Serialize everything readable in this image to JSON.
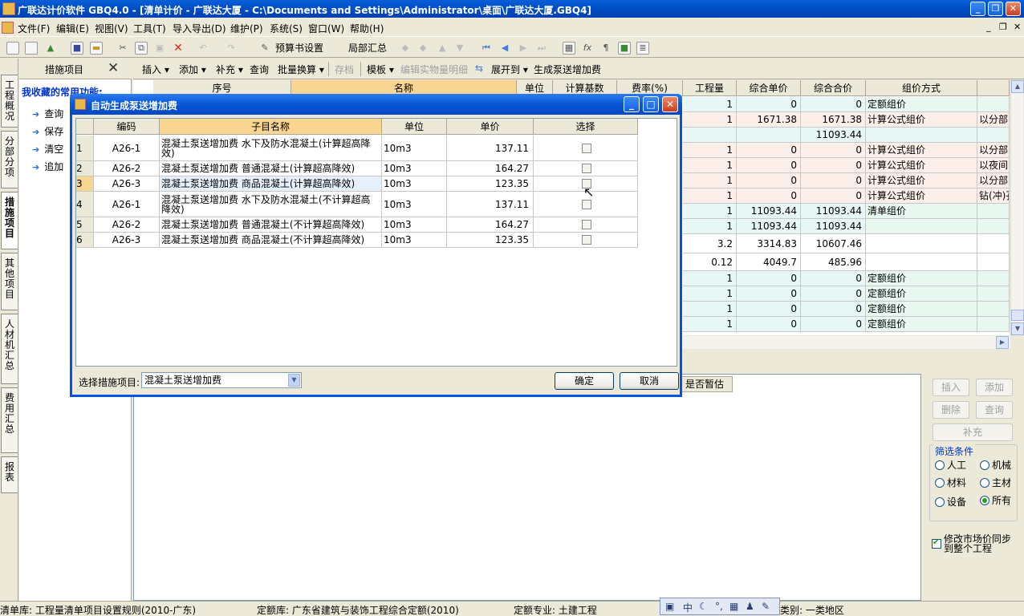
{
  "window": {
    "title": "广联达计价软件 GBQ4.0 - [清单计价 - 广联达大厦 - C:\\Documents and Settings\\Administrator\\桌面\\广联达大厦.GBQ4]"
  },
  "menubar": {
    "items": [
      "文件(F)",
      "编辑(E)",
      "视图(V)",
      "工具(T)",
      "导入导出(D)",
      "维护(P)",
      "系统(S)",
      "窗口(W)",
      "帮助(H)"
    ]
  },
  "toolbar": {
    "budget_settings": "预算书设置",
    "local_summary": "局部汇总"
  },
  "left_tabs": [
    "工程概况",
    "分部分项",
    "措施项目",
    "其他项目",
    "人材机汇总",
    "费用汇总",
    "报表"
  ],
  "left_panel": {
    "title": "措施项目",
    "favorites_title": "我收藏的常用功能:",
    "items": [
      "查询",
      "保存",
      "清空",
      "追加"
    ]
  },
  "toolbar2": {
    "insert": "插入",
    "add": "添加",
    "supplement": "补充",
    "query": "查询",
    "batch_convert": "批量换算",
    "archive": "存档",
    "template": "模板",
    "edit_detail": "编辑实物量明细",
    "expand_to": "展开到",
    "generate_pump": "生成泵送增加费"
  },
  "grid": {
    "headers": [
      "序号",
      "名称",
      "单位",
      "计算基数",
      "费率(%)",
      "工程量",
      "综合单价",
      "综合合价",
      "组价方式"
    ],
    "rows": [
      {
        "qty": "1",
        "unit_price": "0",
        "total": "0",
        "method": "定额组价",
        "extra": "",
        "bg": "#E8F8F0"
      },
      {
        "qty": "1",
        "unit_price": "1671.38",
        "total": "1671.38",
        "method": "计算公式组价",
        "extra": "以分部:",
        "bg": "#FCEEE8"
      },
      {
        "qty": "",
        "unit_price": "",
        "total": "11093.44",
        "method": "",
        "extra": "",
        "bg": "#E8F8F4"
      },
      {
        "qty": "1",
        "unit_price": "0",
        "total": "0",
        "method": "计算公式组价",
        "extra": "以分部:",
        "bg": "#FCEEE8"
      },
      {
        "qty": "1",
        "unit_price": "0",
        "total": "0",
        "method": "计算公式组价",
        "extra": "以夜间:",
        "bg": "#FCEEE8"
      },
      {
        "qty": "1",
        "unit_price": "0",
        "total": "0",
        "method": "计算公式组价",
        "extra": "以分部:",
        "bg": "#FCEEE8"
      },
      {
        "qty": "1",
        "unit_price": "0",
        "total": "0",
        "method": "计算公式组价",
        "extra": "钻(冲)孔",
        "bg": "#FCEEE8"
      },
      {
        "qty": "1",
        "unit_price": "11093.44",
        "total": "11093.44",
        "method": "清单组价",
        "extra": "",
        "bg": "#E8F8F0"
      },
      {
        "qty": "1",
        "unit_price": "11093.44",
        "total": "11093.44",
        "method": "",
        "extra": "",
        "bg": "#E8F8F0"
      },
      {
        "qty": "3.2",
        "unit_price": "3314.83",
        "total": "10607.46",
        "method": "",
        "extra": "",
        "bg": "#FFFFFF"
      },
      {
        "qty": "0.12",
        "unit_price": "4049.7",
        "total": "485.96",
        "method": "",
        "extra": "",
        "bg": "#FFFFFF"
      },
      {
        "qty": "1",
        "unit_price": "0",
        "total": "0",
        "method": "定额组价",
        "extra": "",
        "bg": "#E8F8F0"
      },
      {
        "qty": "1",
        "unit_price": "0",
        "total": "0",
        "method": "定额组价",
        "extra": "",
        "bg": "#E8F8F0"
      },
      {
        "qty": "1",
        "unit_price": "0",
        "total": "0",
        "method": "定额组价",
        "extra": "",
        "bg": "#E8F8F0"
      },
      {
        "qty": "1",
        "unit_price": "0",
        "total": "0",
        "method": "定额组价",
        "extra": "",
        "bg": "#E8F8F0"
      }
    ]
  },
  "bottom": {
    "column_header": "是否暂估",
    "buttons": {
      "insert": "插入",
      "add": "添加",
      "delete": "删除",
      "query": "查询",
      "supplement": "补充"
    },
    "filter_title": "筛选条件",
    "filters": {
      "labor": "人工",
      "machine": "机械",
      "material": "材料",
      "main_material": "主材",
      "equipment": "设备",
      "all": "所有"
    },
    "sync_label": "修改市场价同步到整个工程"
  },
  "dialog": {
    "title": "自动生成泵送增加费",
    "headers": [
      "编码",
      "子目名称",
      "单位",
      "单价",
      "选择"
    ],
    "rows": [
      {
        "no": "1",
        "code": "A26-1",
        "name": "混凝土泵送增加费 水下及防水混凝土(计算超高降效)",
        "unit": "10m3",
        "price": "137.11",
        "checked": false
      },
      {
        "no": "2",
        "code": "A26-2",
        "name": "混凝土泵送增加费 普通混凝土(计算超高降效)",
        "unit": "10m3",
        "price": "164.27",
        "checked": false
      },
      {
        "no": "3",
        "code": "A26-3",
        "name": "混凝土泵送增加费 商品混凝土(计算超高降效)",
        "unit": "10m3",
        "price": "123.35",
        "checked": false
      },
      {
        "no": "4",
        "code": "A26-1",
        "name": "混凝土泵送增加费 水下及防水混凝土(不计算超高降效)",
        "unit": "10m3",
        "price": "137.11",
        "checked": false
      },
      {
        "no": "5",
        "code": "A26-2",
        "name": "混凝土泵送增加费 普通混凝土(不计算超高降效)",
        "unit": "10m3",
        "price": "164.27",
        "checked": false
      },
      {
        "no": "6",
        "code": "A26-3",
        "name": "混凝土泵送增加费 商品混凝土(不计算超高降效)",
        "unit": "10m3",
        "price": "123.35",
        "checked": false
      }
    ],
    "select_label": "选择措施项目:",
    "select_value": "混凝土泵送增加费",
    "ok": "确定",
    "cancel": "取消"
  },
  "statusbar": {
    "bill_library": "清单库: 工程量清单项目设置规则(2010-广东)",
    "quota_library": "定额库: 广东省建筑与装饰工程综合定额(2010)",
    "quota_major": "定额专业: 土建工程",
    "region": "区类别: 一类地区"
  }
}
